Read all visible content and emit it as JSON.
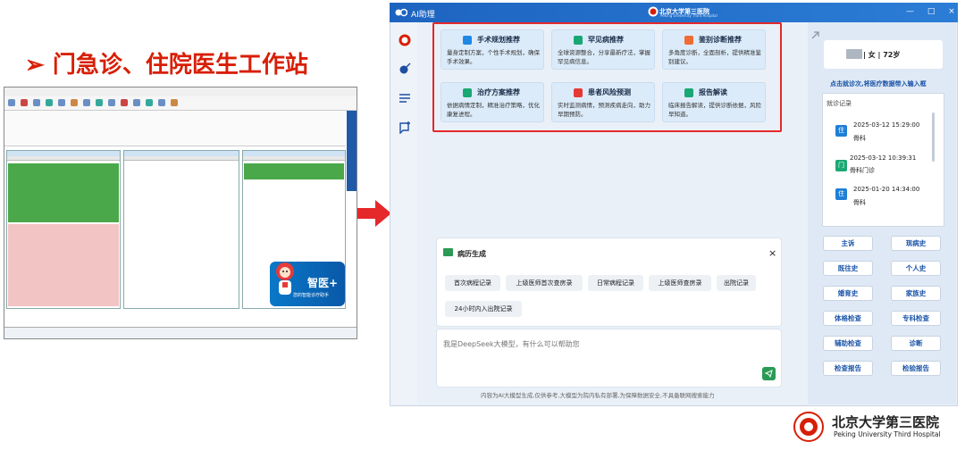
{
  "slide": {
    "title": "➢ 门急诊、住院医生工作站"
  },
  "old_workstation": {
    "mascot_title": "智医+",
    "mascot_subtitle": "您的智能诊疗助手"
  },
  "ai_window": {
    "app_name": "AI助理",
    "hospital_name": "北京大学第三医院",
    "hospital_name_en": "Peking University Third Hospital",
    "window_controls": "— □ ×",
    "features": [
      {
        "title": "手术规划推荐",
        "desc": "量身定制方案，个性手术规划，确保手术效果。",
        "color": "#1e88e5"
      },
      {
        "title": "罕见病推荐",
        "desc": "全球资源整合，分享最新疗法，掌握罕见病信息。",
        "color": "#19a874"
      },
      {
        "title": "鉴别诊断推荐",
        "desc": "多角度诊断，全面剖析，提供精准鉴别建议。",
        "color": "#ef6c35"
      },
      {
        "title": "治疗方案推荐",
        "desc": "依据病情定制，精准治疗策略，优化康复进程。",
        "color": "#19a874"
      },
      {
        "title": "患者风险预测",
        "desc": "实时监测病情，预测疾病走向，助力早期预防。",
        "color": "#e53935"
      },
      {
        "title": "报告解读",
        "desc": "临床报告解读，提供诊断依据，风险早知道。",
        "color": "#19a874"
      }
    ],
    "history_title": "病历生成",
    "history_close": "×",
    "record_buttons": [
      "首次病程记录",
      "上级医师首次查房录",
      "日常病程记录",
      "上级医师查房录",
      "出院记录",
      "24小时内入出院记录"
    ],
    "chat_placeholder": "我是DeepSeek大模型，有什么可以帮助您",
    "disclaimer": "内容为AI大模型生成,仅供参考,大模型为院内私有部署,为保障数据安全,不具备联网搜索能力"
  },
  "patient_panel": {
    "patient_info": "| 女 | 72岁",
    "import_link": "点击就诊次,将医疗数据带入输入框",
    "visit_label": "就诊记录",
    "visits": [
      {
        "badge": "住",
        "badge_color": "#1e7fd6",
        "date": "2025-03-12 15:29:00",
        "dept": "骨科"
      },
      {
        "badge": "门",
        "badge_color": "#19a874",
        "date": "2025-03-12 10:39:31",
        "dept": "骨科门诊"
      },
      {
        "badge": "住",
        "badge_color": "#1e7fd6",
        "date": "2025-01-20 14:34:00",
        "dept": "骨科"
      }
    ],
    "buttons": [
      "主诉",
      "现病史",
      "既往史",
      "个人史",
      "婚育史",
      "家族史",
      "体格检查",
      "专科检查",
      "辅助检查",
      "诊断",
      "检查报告",
      "检验报告"
    ]
  },
  "footer_logo": {
    "cn": "北京大学第三医院",
    "en": "Peking University Third Hospital"
  }
}
